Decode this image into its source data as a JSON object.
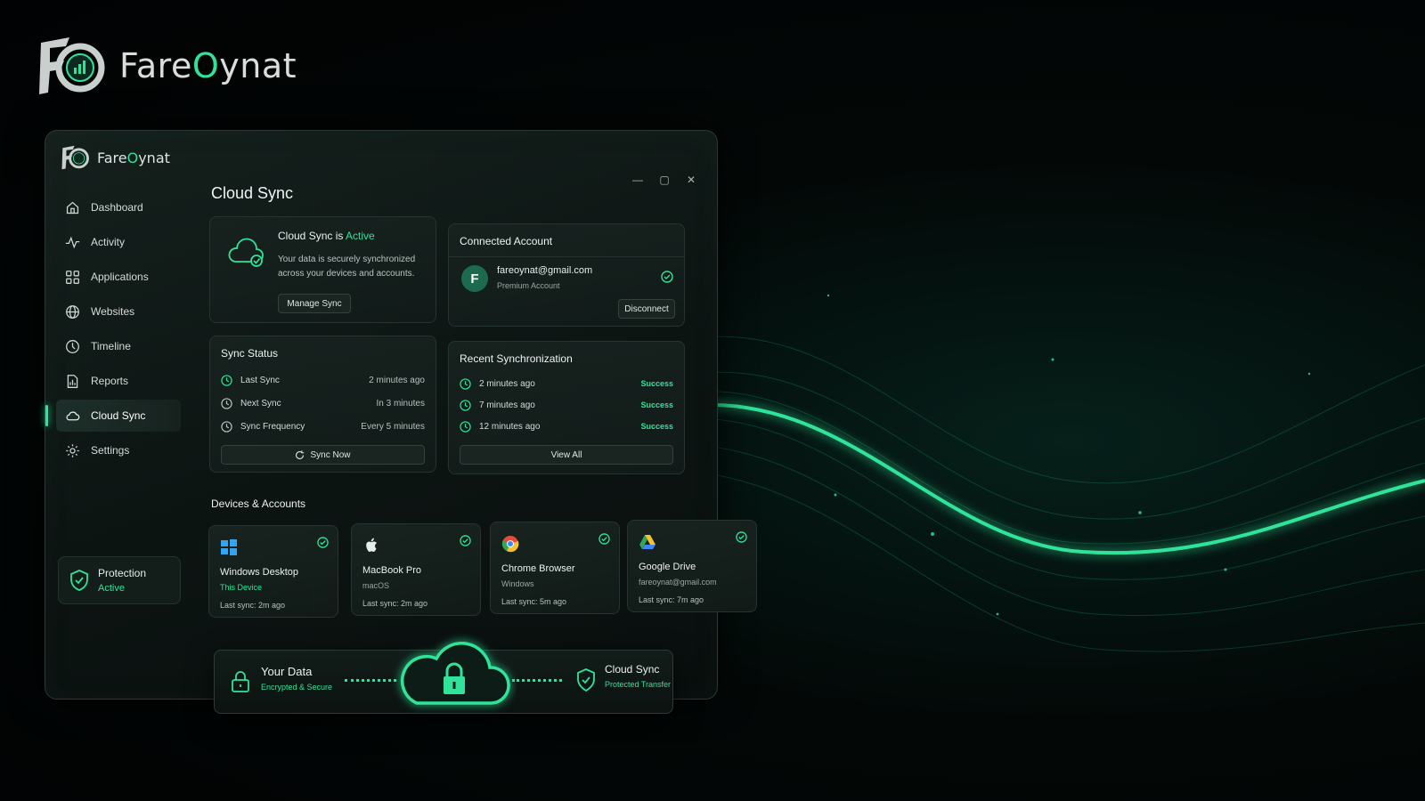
{
  "brand": {
    "name_pre": "Fare",
    "name_o": "O",
    "name_post": "ynat"
  },
  "window_controls": {
    "minimize": "—",
    "maximize": "▢",
    "close": "✕"
  },
  "sidebar": {
    "items": [
      {
        "label": "Dashboard",
        "icon": "home-icon"
      },
      {
        "label": "Activity",
        "icon": "pulse-icon"
      },
      {
        "label": "Applications",
        "icon": "apps-icon"
      },
      {
        "label": "Websites",
        "icon": "globe-icon"
      },
      {
        "label": "Timeline",
        "icon": "timeline-icon"
      },
      {
        "label": "Reports",
        "icon": "reports-icon"
      },
      {
        "label": "Cloud Sync",
        "icon": "cloud-icon",
        "active": true
      },
      {
        "label": "Settings",
        "icon": "gear-icon"
      }
    ],
    "protection": {
      "title": "Protection",
      "status": "Active"
    }
  },
  "page": {
    "title": "Cloud Sync"
  },
  "sync_active": {
    "head_prefix": "Cloud Sync is ",
    "head_status": "Active",
    "description": "Your data is securely synchronized across your devices and accounts.",
    "button": "Manage Sync"
  },
  "account": {
    "title": "Connected Account",
    "avatar_letter": "F",
    "email": "fareoynat@gmail.com",
    "plan": "Premium Account",
    "button": "Disconnect"
  },
  "sync_status": {
    "title": "Sync Status",
    "rows": [
      {
        "label": "Last Sync",
        "value": "2 minutes ago"
      },
      {
        "label": "Next Sync",
        "value": "In 3 minutes"
      },
      {
        "label": "Sync Frequency",
        "value": "Every 5 minutes"
      }
    ],
    "button": "Sync Now"
  },
  "recent": {
    "title": "Recent Synchronization",
    "rows": [
      {
        "time": "2 minutes ago",
        "status": "Success"
      },
      {
        "time": "7 minutes ago",
        "status": "Success"
      },
      {
        "time": "12 minutes ago",
        "status": "Success"
      }
    ],
    "button": "View All"
  },
  "devices": {
    "title": "Devices & Accounts",
    "items": [
      {
        "name": "Windows Desktop",
        "sub": "This Device",
        "last": "Last sync: 2m ago",
        "icon": "windows-icon"
      },
      {
        "name": "MacBook Pro",
        "sub": "macOS",
        "last": "Last sync: 2m ago",
        "icon": "apple-icon"
      },
      {
        "name": "Chrome Browser",
        "sub": "Windows",
        "last": "Last sync: 5m ago",
        "icon": "chrome-icon"
      },
      {
        "name": "Google Drive",
        "sub": "fareoynat@gmail.com",
        "last": "Last sync: 7m ago",
        "icon": "google-drive-icon"
      }
    ]
  },
  "banner": {
    "left_title": "Your Data",
    "left_sub": "Encrypted & Secure",
    "right_title": "Cloud Sync",
    "right_sub": "Protected Transfer"
  },
  "colors": {
    "accent": "#2fe39a",
    "background": "#030807",
    "panel": "#17221f"
  }
}
